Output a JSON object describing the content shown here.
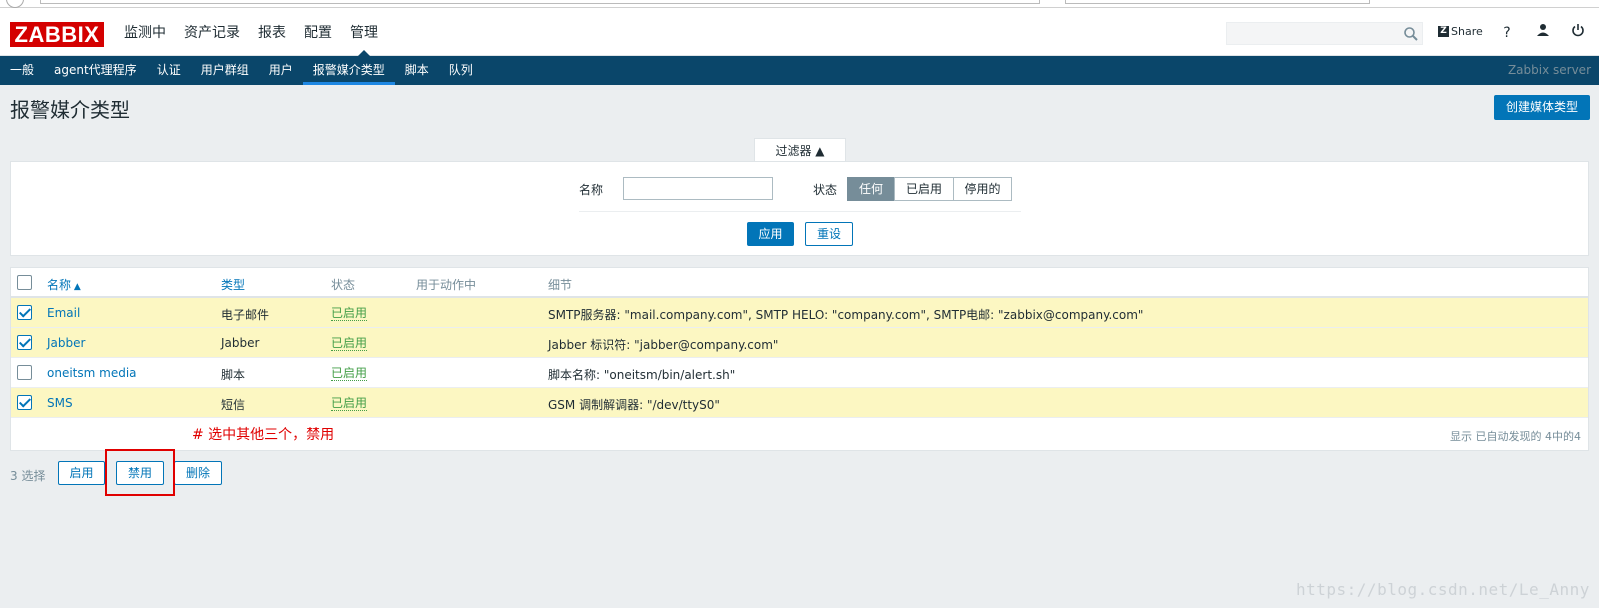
{
  "header": {
    "logo": "ZABBIX",
    "main_nav": [
      "监测中",
      "资产记录",
      "报表",
      "配置",
      "管理"
    ],
    "share_label": "Share",
    "help_glyph": "?"
  },
  "subnav": {
    "items": [
      "一般",
      "agent代理程序",
      "认证",
      "用户群组",
      "用户",
      "报警媒介类型",
      "脚本",
      "队列"
    ],
    "server": "Zabbix server"
  },
  "page": {
    "title": "报警媒介类型",
    "create_button": "创建媒体类型"
  },
  "filter": {
    "tab_label": "过滤器",
    "name_label": "名称",
    "name_value": "",
    "status_label": "状态",
    "status_options": [
      "任何",
      "已启用",
      "停用的"
    ],
    "status_selected": "任何",
    "apply": "应用",
    "reset": "重设"
  },
  "table": {
    "headers": {
      "name": "名称",
      "type": "类型",
      "status": "状态",
      "used_in_actions": "用于动作中",
      "details": "细节"
    },
    "rows": [
      {
        "checked": true,
        "name": "Email",
        "type": "电子邮件",
        "status": "已启用",
        "details": "SMTP服务器: \"mail.company.com\", SMTP HELO: \"company.com\", SMTP电邮: \"zabbix@company.com\""
      },
      {
        "checked": true,
        "name": "Jabber",
        "type": "Jabber",
        "status": "已启用",
        "details": "Jabber 标识符: \"jabber@company.com\""
      },
      {
        "checked": false,
        "name": "oneitsm media",
        "type": "脚本",
        "status": "已启用",
        "details": "脚本名称: \"oneitsm/bin/alert.sh\""
      },
      {
        "checked": true,
        "name": "SMS",
        "type": "短信",
        "status": "已启用",
        "details": "GSM 调制解调器: \"/dev/ttyS0\""
      }
    ],
    "footer_info": "显示 已自动发现的 4中的4"
  },
  "annotation": "# 选中其他三个，禁用",
  "actions": {
    "selected_count": "3 选择",
    "enable": "启用",
    "disable": "禁用",
    "delete": "删除"
  },
  "watermark": "https://blog.csdn.net/Le_Anny",
  "colors": {
    "brand_red": "#d40000",
    "subnav_bg": "#0a466a",
    "accent_blue": "#0275b8",
    "status_green": "#429e47",
    "row_highlight": "#fcf7c2"
  }
}
